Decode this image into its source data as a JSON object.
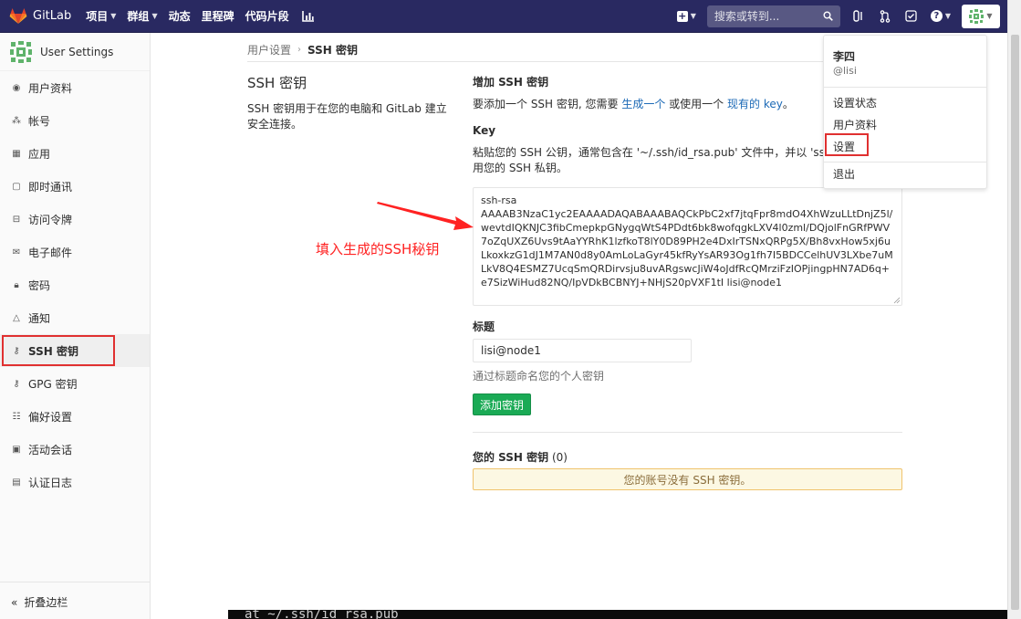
{
  "nav": {
    "brand": "GitLab",
    "menu": [
      "项目",
      "群组",
      "动态",
      "里程碑",
      "代码片段"
    ],
    "search_placeholder": "搜索或转到..."
  },
  "sidebar": {
    "title": "User Settings",
    "items": [
      "用户资料",
      "帐号",
      "应用",
      "即时通讯",
      "访问令牌",
      "电子邮件",
      "密码",
      "通知",
      "SSH 密钥",
      "GPG 密钥",
      "偏好设置",
      "活动会话",
      "认证日志"
    ],
    "active_index": 8,
    "collapse_label": "折叠边栏"
  },
  "breadcrumb": {
    "parent": "用户设置",
    "current": "SSH 密钥"
  },
  "left": {
    "title": "SSH 密钥",
    "description": "SSH 密钥用于在您的电脑和 GitLab 建立安全连接。"
  },
  "add": {
    "title": "增加 SSH 密钥",
    "intro_before": "要添加一个 SSH 密钥, 您需要 ",
    "intro_link1": "生成一个",
    "intro_mid": " 或使用一个 ",
    "intro_link2": "现有的 key",
    "intro_after": "。",
    "key_label": "Key",
    "key_help": "粘贴您的 SSH 公钥，通常包含在 '~/.ssh/id_rsa.pub' 文件中，并以 'ssh-rs",
    "key_help2": "用您的 SSH 私钥。",
    "key_value": "ssh-rsa\nAAAAB3NzaC1yc2EAAAADAQABAAABAQCkPbC2xf7jtqFpr8mdO4XhWzuLLtDnjZ5l/wevtdIQKNJC3fibCmepkpGNygqWtS4PDdt6bk8wofqgkLXV4l0zml/DQjolFnGRfPWV7oZqUXZ6Uvs9tAaYYRhK1lzfkoT8lY0D89PH2e4DxIrTSNxQRPg5X/Bh8vxHow5xj6uLkoxkzG1dJ1M7AN0d8y0AmLoLaGyr45kfRyYsAR93Og1fh7I5BDCCelhUV3LXbe7uMLkV8Q4ESMZ7UcqSmQRDirvsju8uvARgswcJiW4oJdfRcQMrziFzIOPjingpHN7AD6q+e7SizWiHud82NQ/IpVDkBCBNYJ+NHjS20pVXF1tI lisi@node1",
    "title_label": "标题",
    "title_value": "lisi@node1",
    "title_help": "通过标题命名您的个人密钥",
    "submit": "添加密钥"
  },
  "keys": {
    "title": "您的 SSH 密钥",
    "count": "(0)",
    "empty": "您的账号没有 SSH 密钥。"
  },
  "annotation": "填入生成的SSH秘钥",
  "dropdown": {
    "name": "李四",
    "username": "@lisi",
    "items": [
      "设置状态",
      "用户资料",
      "设置",
      "退出"
    ]
  },
  "terminal_fragment": "at  ~/.ssh/id_rsa.pub",
  "colors": {
    "nav": "#292961",
    "accent_link": "#1b69b6",
    "success": "#1aaa55",
    "highlight": "#e03030",
    "annotation": "#ff2222"
  }
}
